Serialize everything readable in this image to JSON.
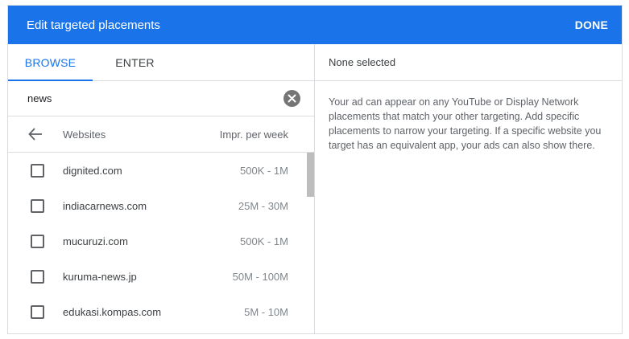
{
  "dialog": {
    "title": "Edit targeted placements",
    "done_label": "DONE"
  },
  "tabs": [
    {
      "label": "BROWSE",
      "active": true
    },
    {
      "label": "ENTER",
      "active": false
    }
  ],
  "search": {
    "value": "news",
    "clear_icon": "clear-circle-icon"
  },
  "list_header": {
    "back_icon": "arrow-back-icon",
    "websites_label": "Websites",
    "impressions_label": "Impr. per week"
  },
  "results": [
    {
      "site": "dignited.com",
      "impressions": "500K - 1M",
      "checked": false
    },
    {
      "site": "indiacarnews.com",
      "impressions": "25M - 30M",
      "checked": false
    },
    {
      "site": "mucuruzi.com",
      "impressions": "500K - 1M",
      "checked": false
    },
    {
      "site": "kuruma-news.jp",
      "impressions": "50M - 100M",
      "checked": false
    },
    {
      "site": "edukasi.kompas.com",
      "impressions": "5M - 10M",
      "checked": false
    }
  ],
  "selection": {
    "status": "None selected",
    "info": "Your ad can appear on any YouTube or Display Network placements that match your other targeting. Add specific placements to narrow your targeting. If a specific website you target has an equivalent app, your ads can also show there."
  },
  "colors": {
    "header_bg": "#1a73e8",
    "accent": "#1a73e8",
    "divider": "#dadce0"
  }
}
